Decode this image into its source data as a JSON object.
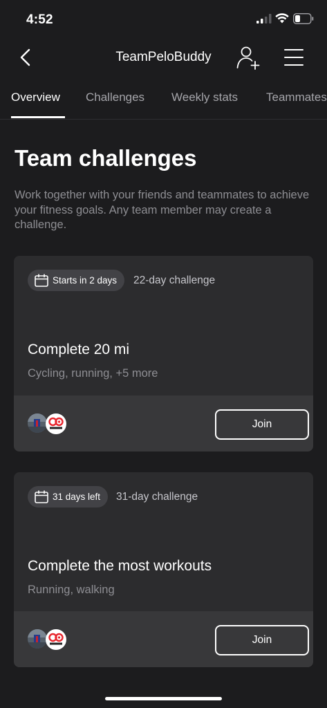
{
  "status": {
    "time": "4:52"
  },
  "nav": {
    "title": "TeamPeloBuddy",
    "icons": [
      "back-chevron-icon",
      "add-person-icon",
      "hamburger-menu-icon"
    ]
  },
  "tabs": [
    {
      "label": "Overview",
      "active": true
    },
    {
      "label": "Challenges",
      "active": false
    },
    {
      "label": "Weekly stats",
      "active": false
    },
    {
      "label": "Teammates",
      "active": false
    }
  ],
  "section": {
    "title": "Team challenges",
    "description": "Work together with your friends and teammates to achieve your fitness goals. Any team member may create a challenge."
  },
  "challenges": [
    {
      "badge": "Starts in 2 days",
      "duration": "22-day challenge",
      "title": "Complete 20 mi",
      "activities": "Cycling, running, +5 more",
      "join_label": "Join"
    },
    {
      "badge": "31 days left",
      "duration": "31-day challenge",
      "title": "Complete the most workouts",
      "activities": "Running, walking",
      "join_label": "Join"
    }
  ],
  "colors": {
    "background": "#1c1c1e",
    "card": "#2c2c2e",
    "card_footer": "#38383a",
    "muted_text": "#8e8e93",
    "logo_red": "#e8242c"
  }
}
